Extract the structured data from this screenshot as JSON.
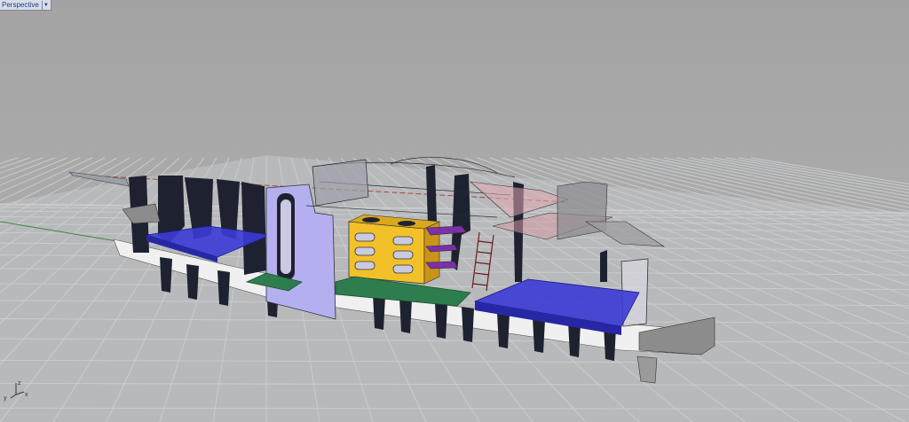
{
  "viewport": {
    "name": "Perspective",
    "menu_icon": "chevron-down-icon"
  },
  "axis_widget": {
    "x": "x",
    "y": "y",
    "z": "z"
  },
  "colors": {
    "background": "#a6a6a6",
    "grid_line": "#c4c8cc",
    "x_axis": "#b04040",
    "y_axis": "#3a8a3a",
    "bunk": "#3b3bd6",
    "bulkhead": "#b4b0f0",
    "cabinet": "#f2c12a",
    "floor": "#2e7d4f",
    "shelf": "#7b2fa8",
    "frame": "#1e2230"
  }
}
